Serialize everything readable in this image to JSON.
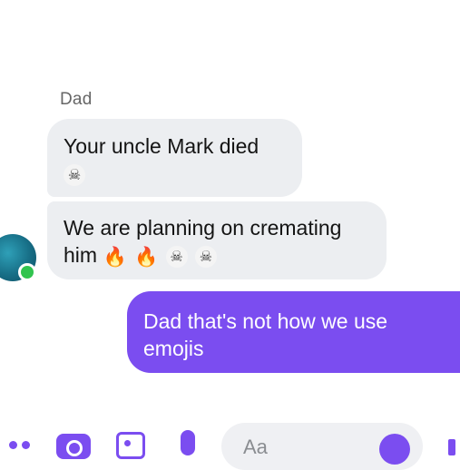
{
  "conversation": {
    "sender_name": "Dad",
    "messages": [
      {
        "direction": "incoming",
        "lines": [
          "Your uncle Mark died"
        ],
        "emojis": [
          "skull"
        ]
      },
      {
        "direction": "incoming",
        "lines": [
          "We are planning on cremating",
          "him"
        ],
        "emojis": [
          "fire",
          "fire",
          "skull",
          "skull"
        ]
      },
      {
        "direction": "outgoing",
        "lines": [
          "Dad that's not how we use",
          "emojis"
        ]
      }
    ]
  },
  "composer": {
    "placeholder": "Aa"
  },
  "colors": {
    "accent": "#7b4df0",
    "incoming_bubble": "#eceef1",
    "online": "#31c44f"
  },
  "icons": {
    "skull": "☠",
    "fire": "🔥"
  }
}
